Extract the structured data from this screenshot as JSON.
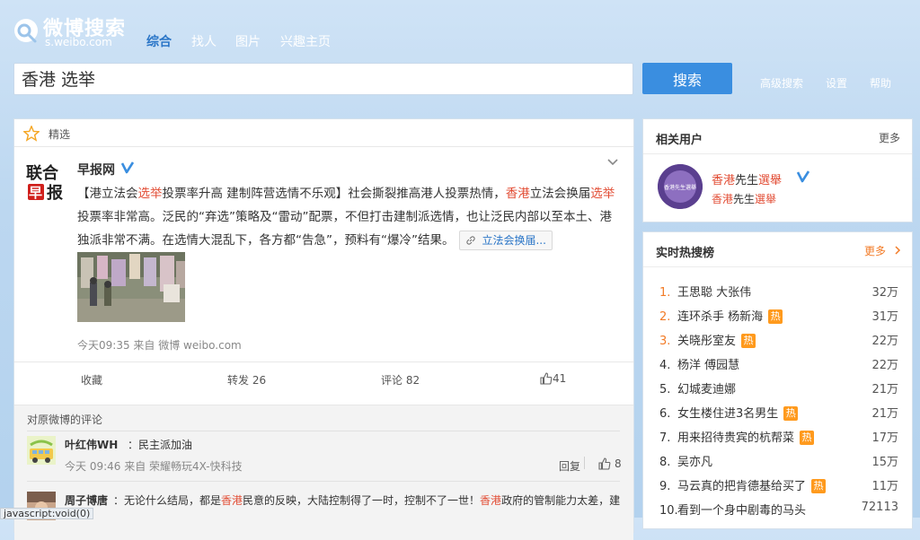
{
  "header": {
    "logo_text": "微博搜索",
    "logo_sub": "s.weibo.com",
    "nav": [
      "综合",
      "找人",
      "图片",
      "兴趣主页"
    ],
    "search_value": "香港 选举",
    "search_button": "搜索",
    "links": [
      "高级搜索",
      "设置",
      "帮助"
    ]
  },
  "main": {
    "featured_label": "精选",
    "post": {
      "author": "早报网",
      "avatar_text": "联合早报",
      "text_parts": [
        {
          "t": "【港立法会",
          "c": ""
        },
        {
          "t": "选举",
          "c": "red"
        },
        {
          "t": "投票率升高 建制阵营选情不乐观】社会撕裂推高港人投票热情，",
          "c": ""
        },
        {
          "t": "香港",
          "c": "red"
        },
        {
          "t": "立法会换届",
          "c": ""
        },
        {
          "t": "选举",
          "c": "red"
        },
        {
          "t": "投票率非常高。泛民的“弃选”策略及“雷动”配票，不但打击建制派选情，也让泛民内部以至本土、港独派非常不满。在选情大混乱下，各方都“告急”，预料有“爆冷”结果。",
          "c": ""
        }
      ],
      "link_chip": "立法会换届...",
      "meta": "今天09:35 来自 微博 weibo.com",
      "actions": {
        "favorite": "收藏",
        "repost": "转发 26",
        "comment": "评论 82",
        "like": "41"
      }
    },
    "comments": {
      "title": "对原微博的评论",
      "items": [
        {
          "name": "叶红伟WH",
          "text": "：民主派加油",
          "meta": "今天 09:46 来自 荣耀畅玩4X-快科技",
          "reply": "回复",
          "likes": "8"
        },
        {
          "name": "周子博唐",
          "text_parts": [
            {
              "t": "：无论什么结局，都是",
              "c": ""
            },
            {
              "t": "香港",
              "c": "red"
            },
            {
              "t": "民意的反映，大陆控制得了一时，控制不了一世！",
              "c": ""
            },
            {
              "t": "香港",
              "c": "red"
            },
            {
              "t": "政府的管制能力太差，建",
              "c": ""
            }
          ]
        }
      ]
    }
  },
  "sidebar": {
    "related_users": {
      "title": "相关用户",
      "more": "更多",
      "user_name_parts": [
        {
          "t": "香港",
          "c": "red"
        },
        {
          "t": "先生",
          "c": ""
        },
        {
          "t": "選舉",
          "c": "red"
        }
      ],
      "user_desc_parts": [
        {
          "t": "香港",
          "c": "red"
        },
        {
          "t": "先生",
          "c": ""
        },
        {
          "t": "選舉",
          "c": "red"
        }
      ],
      "avatar_text": "香港先生選舉"
    },
    "hot_search": {
      "title": "实时热搜榜",
      "more": "更多",
      "items": [
        {
          "rank": "1.",
          "text": "王思聪 大张伟",
          "hot": false,
          "count": "32万"
        },
        {
          "rank": "2.",
          "text": "连环杀手 杨新海",
          "hot": true,
          "count": "31万"
        },
        {
          "rank": "3.",
          "text": "关晓彤室友",
          "hot": true,
          "count": "22万"
        },
        {
          "rank": "4.",
          "text": "杨洋 傅园慧",
          "hot": false,
          "count": "22万"
        },
        {
          "rank": "5.",
          "text": "幻城麦迪娜",
          "hot": false,
          "count": "21万"
        },
        {
          "rank": "6.",
          "text": "女生楼住进3名男生",
          "hot": true,
          "count": "21万"
        },
        {
          "rank": "7.",
          "text": "用来招待贵宾的杭帮菜",
          "hot": true,
          "count": "17万"
        },
        {
          "rank": "8.",
          "text": "吴亦凡",
          "hot": false,
          "count": "15万"
        },
        {
          "rank": "9.",
          "text": "马云真的把肯德基给买了",
          "hot": true,
          "count": "11万"
        },
        {
          "rank": "10.",
          "text": "看到一个身中剧毒的马头",
          "hot": false,
          "count": "72113"
        }
      ],
      "hot_badge": "热"
    }
  },
  "status_url": "javascript:void(0)"
}
